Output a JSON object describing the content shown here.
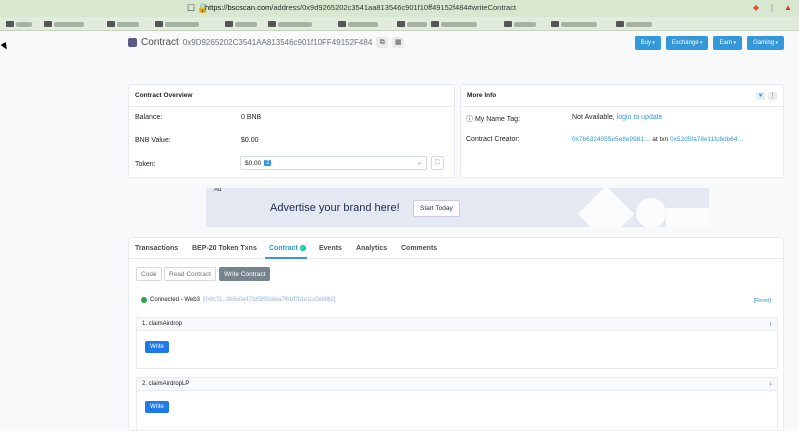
{
  "browser": {
    "url_host": "https://bscscan.com",
    "url_path": "/address/0x9d9265202c3541aa813546c901f10ff49152f484#writeContract"
  },
  "header": {
    "title": "Contract",
    "address": "0x9D9265202C3541AA813546c901f10FF49152F484",
    "buttons": [
      "Buy",
      "Exchange",
      "Earn",
      "Gaming"
    ]
  },
  "overview": {
    "title": "Contract Overview",
    "balance_label": "Balance:",
    "balance_value": "0 BNB",
    "bnb_value_label": "BNB Value:",
    "bnb_value": "$0.00",
    "token_label": "Token:",
    "token_value": "$0.00",
    "token_count": "2"
  },
  "more_info": {
    "title": "More Info",
    "name_tag_label": "My Name Tag:",
    "name_tag_value": "Not Available,",
    "name_tag_link": "login to update",
    "creator_label": "Contract Creator:",
    "creator_address": "0x7b6324055e5e8e9981…",
    "creator_at_txn": "at txn",
    "creator_txn": "0x52d5fa78e11fc6db64…"
  },
  "ad": {
    "label": "Ad",
    "headline": "Advertise your brand here!",
    "cta": "Start Today"
  },
  "tabs": {
    "items": [
      "Transactions",
      "BEP-20 Token Txns",
      "Contract",
      "Events",
      "Analytics",
      "Comments"
    ]
  },
  "contract_subtabs": [
    "Code",
    "Read Contract",
    "Write Contract"
  ],
  "connection": {
    "status": "Connected - Web3",
    "address": "[0x0c71...0fe5c0e472d5893c6ea7f61d7b1e1cc0e6882]",
    "reset": "[Reset]"
  },
  "functions": [
    {
      "title": "1. claimAirdrop",
      "button": "Write"
    },
    {
      "title": "2. claimAirdropLP",
      "button": "Write"
    }
  ]
}
